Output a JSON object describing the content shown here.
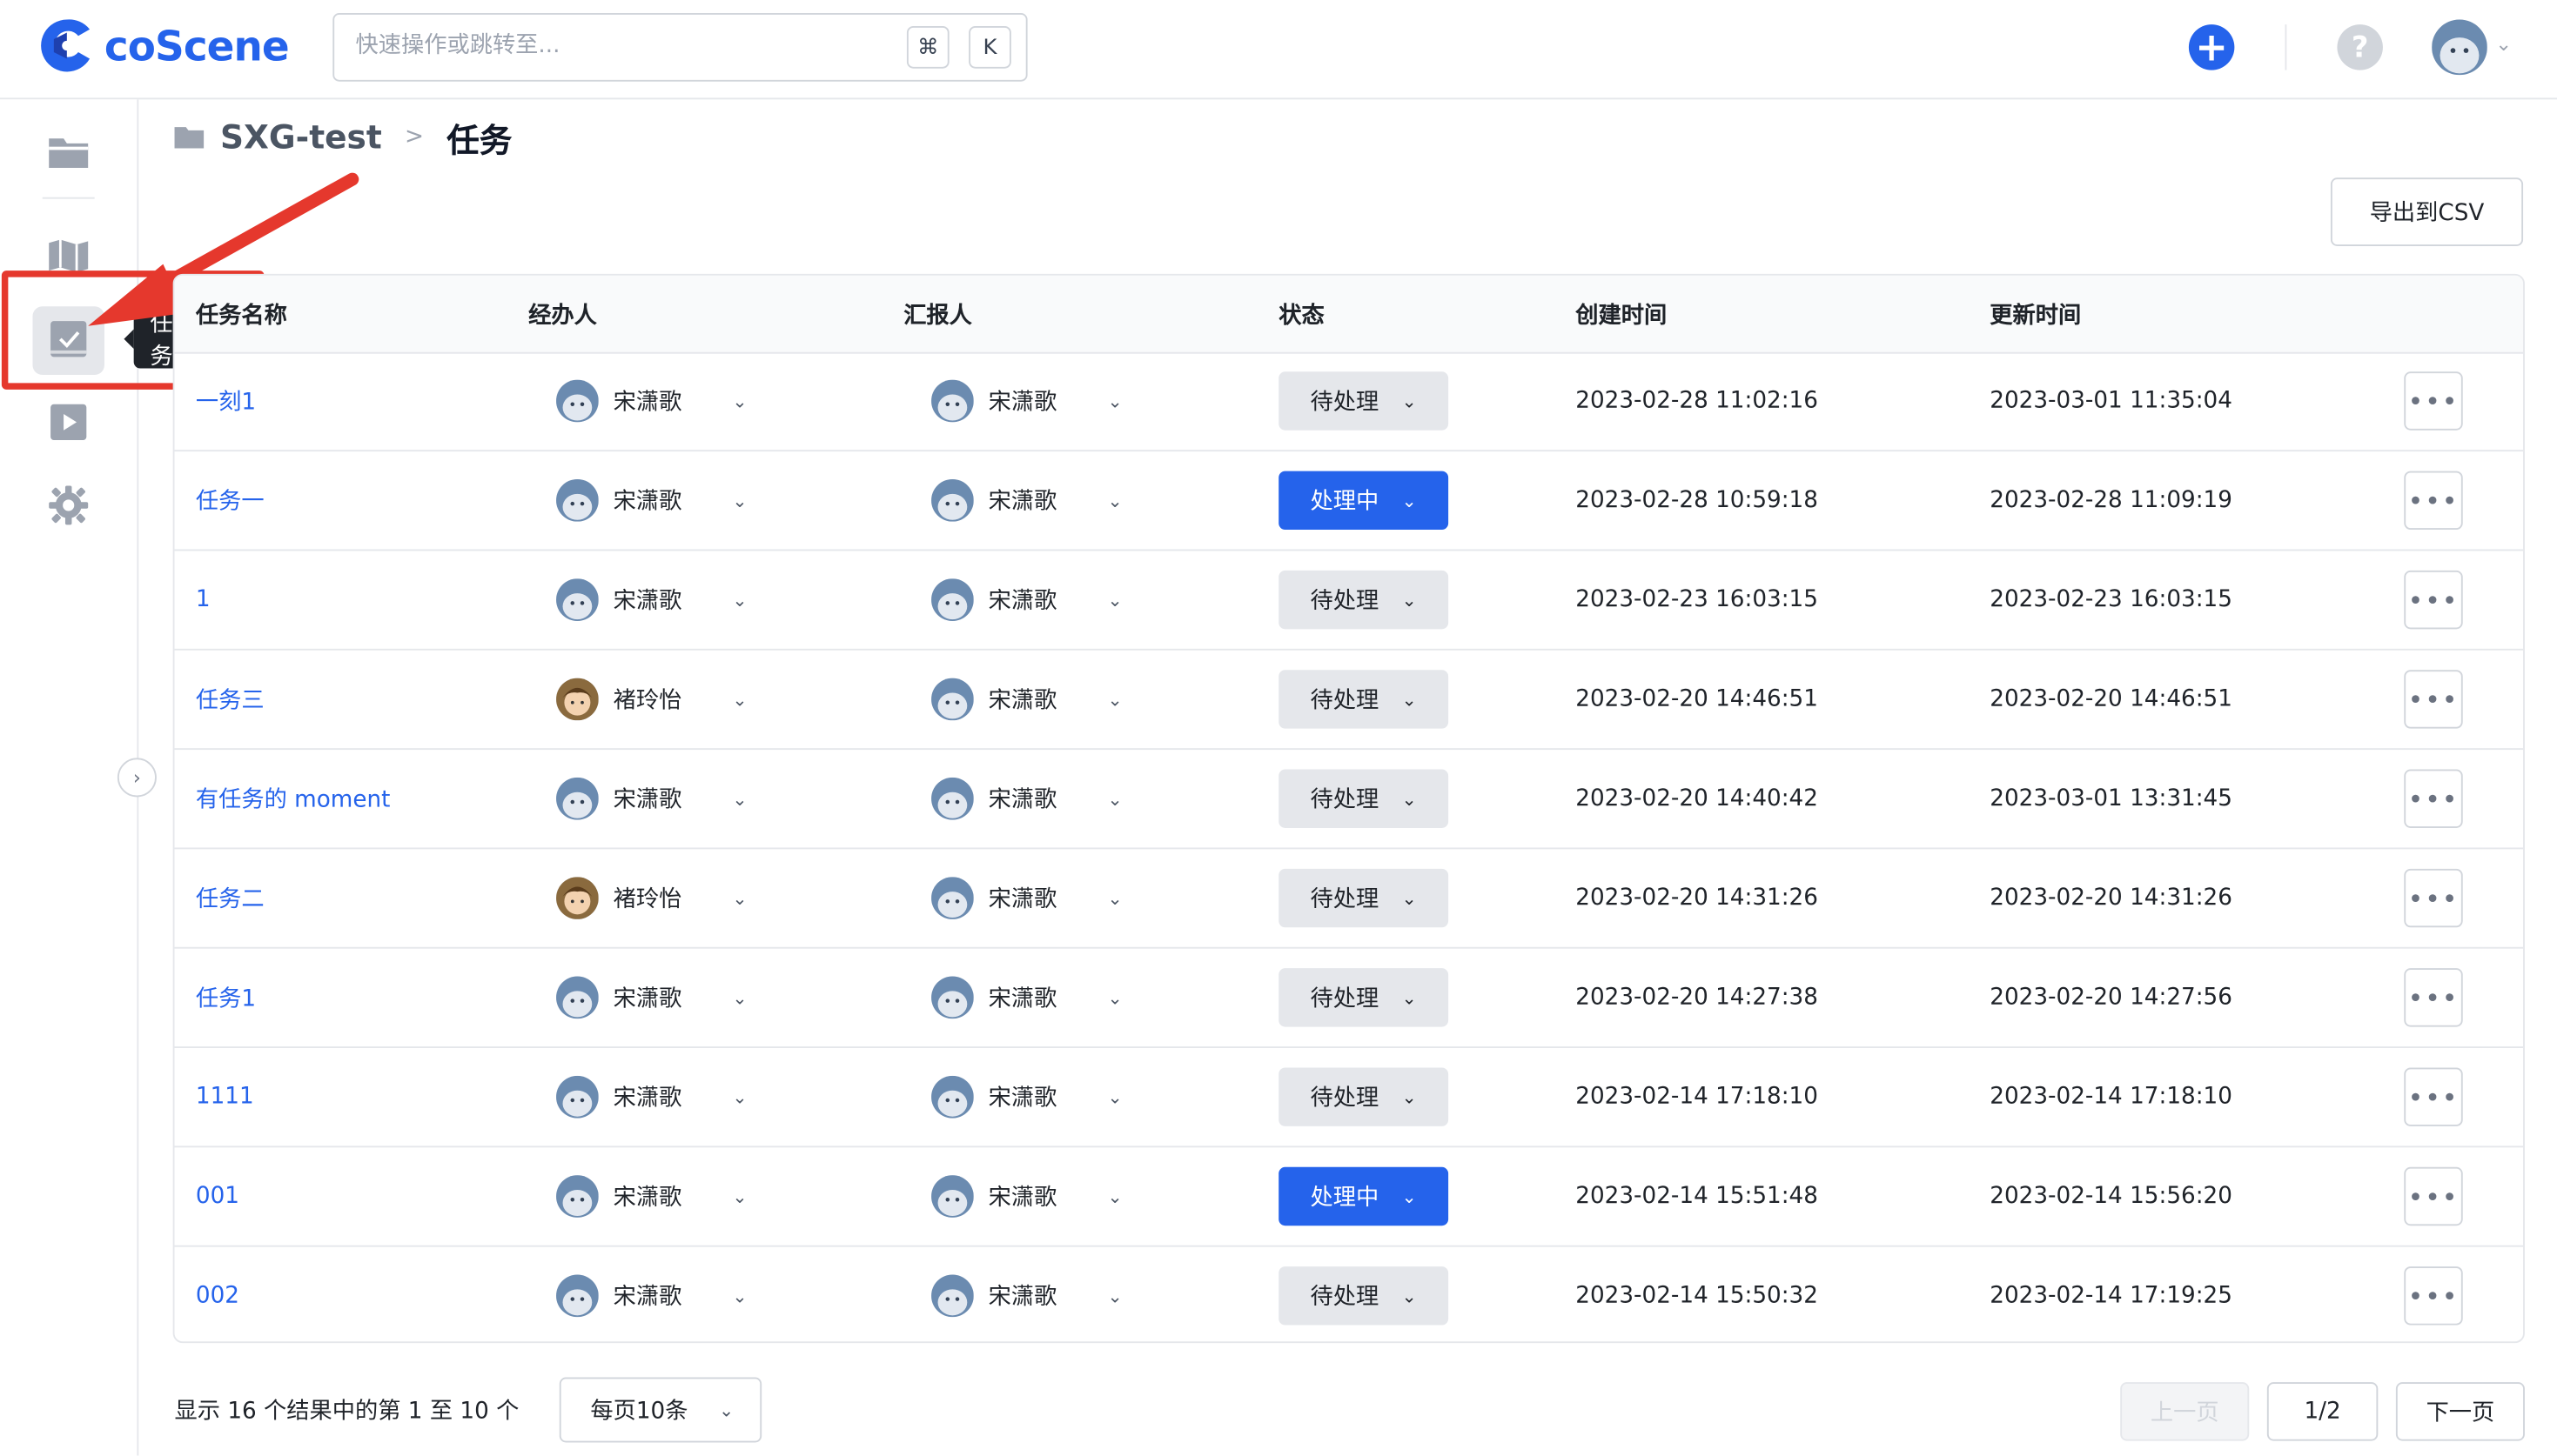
{
  "app": {
    "brand": "coScene",
    "brand_color": "#2563eb"
  },
  "search": {
    "placeholder": "快速操作或跳转至...",
    "shortcut_cmd": "⌘",
    "shortcut_key": "K"
  },
  "header": {
    "help_label": "?"
  },
  "sidebar": {
    "items": [
      {
        "icon": "folder-icon",
        "label": ""
      },
      {
        "icon": "map-icon",
        "label": ""
      },
      {
        "icon": "task-check-icon",
        "label": "任务",
        "active": true
      },
      {
        "icon": "play-icon",
        "label": ""
      },
      {
        "icon": "gear-icon",
        "label": ""
      }
    ],
    "tooltip": "任务"
  },
  "breadcrumb": {
    "project": "SXG-test",
    "separator": ">",
    "current": "任务"
  },
  "toolbar": {
    "export_label": "导出到CSV"
  },
  "table": {
    "columns": [
      "任务名称",
      "经办人",
      "汇报人",
      "状态",
      "创建时间",
      "更新时间"
    ],
    "rows": [
      {
        "name": "一刻1",
        "assignee": "宋潇歌",
        "reporter": "宋潇歌",
        "status": "待处理",
        "created": "2023-02-28 11:02:16",
        "updated": "2023-03-01 11:35:04"
      },
      {
        "name": "任务一",
        "assignee": "宋潇歌",
        "reporter": "宋潇歌",
        "status": "处理中",
        "created": "2023-02-28 10:59:18",
        "updated": "2023-02-28 11:09:19"
      },
      {
        "name": "1",
        "assignee": "宋潇歌",
        "reporter": "宋潇歌",
        "status": "待处理",
        "created": "2023-02-23 16:03:15",
        "updated": "2023-02-23 16:03:15"
      },
      {
        "name": "任务三",
        "assignee": "褚玲怡",
        "reporter": "宋潇歌",
        "status": "待处理",
        "created": "2023-02-20 14:46:51",
        "updated": "2023-02-20 14:46:51"
      },
      {
        "name": "有任务的 moment",
        "assignee": "宋潇歌",
        "reporter": "宋潇歌",
        "status": "待处理",
        "created": "2023-02-20 14:40:42",
        "updated": "2023-03-01 13:31:45"
      },
      {
        "name": "任务二",
        "assignee": "褚玲怡",
        "reporter": "宋潇歌",
        "status": "待处理",
        "created": "2023-02-20 14:31:26",
        "updated": "2023-02-20 14:31:26"
      },
      {
        "name": "任务1",
        "assignee": "宋潇歌",
        "reporter": "宋潇歌",
        "status": "待处理",
        "created": "2023-02-20 14:27:38",
        "updated": "2023-02-20 14:27:56"
      },
      {
        "name": "1111",
        "assignee": "宋潇歌",
        "reporter": "宋潇歌",
        "status": "待处理",
        "created": "2023-02-14 17:18:10",
        "updated": "2023-02-14 17:18:10"
      },
      {
        "name": "001",
        "assignee": "宋潇歌",
        "reporter": "宋潇歌",
        "status": "处理中",
        "created": "2023-02-14 15:51:48",
        "updated": "2023-02-14 15:56:20"
      },
      {
        "name": "002",
        "assignee": "宋潇歌",
        "reporter": "宋潇歌",
        "status": "待处理",
        "created": "2023-02-14 15:50:32",
        "updated": "2023-02-14 17:19:25"
      }
    ],
    "status_colors": {
      "待处理": "#e5e7eb",
      "处理中": "#2563eb"
    }
  },
  "footer": {
    "summary": "显示 16 个结果中的第 1 至 10 个",
    "page_size": "每页10条",
    "prev_label": "上一页",
    "page_indicator": "1/2",
    "next_label": "下一页"
  },
  "annotation": {
    "color": "#e5382d"
  }
}
